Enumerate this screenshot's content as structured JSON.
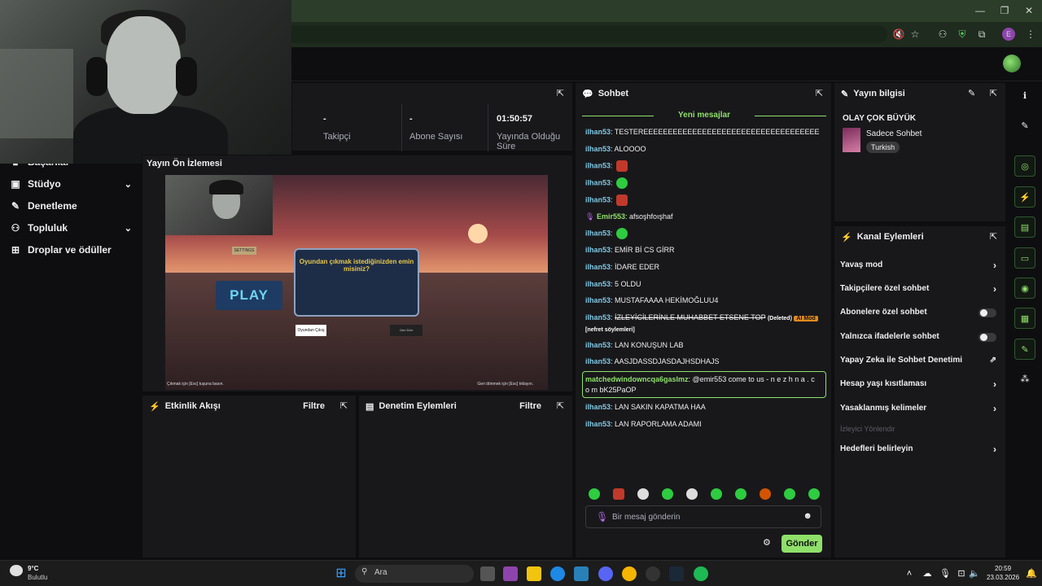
{
  "window": {
    "minimize": "—",
    "restore": "❐",
    "close": "✕"
  },
  "sidebar": {
    "items": [
      {
        "label": "Başarılar",
        "icon": "trophy-icon",
        "chev": ""
      },
      {
        "label": "Stüdyo",
        "icon": "studio-icon",
        "chev": "⌄"
      },
      {
        "label": "Denetleme",
        "icon": "wrench-icon",
        "chev": ""
      },
      {
        "label": "Topluluk",
        "icon": "community-icon",
        "chev": "⌄"
      },
      {
        "label": "Droplar ve ödüller",
        "icon": "gift-icon",
        "chev": ""
      }
    ]
  },
  "stats": {
    "followers_value": "-",
    "followers_label": "Takipçi",
    "subs_value": "-",
    "subs_label": "Abone Sayısı",
    "uptime_value": "01:50:57",
    "uptime_label": "Yayında Olduğu Süre"
  },
  "preview": {
    "title": "Yayın Ön İzlemesi",
    "game_play": "PLAY",
    "game_dialog": "Oyundan çıkmak istediğinizden emin misiniz?",
    "game_btn1": "Oyundan Çıkış",
    "game_btn2": "Geri Dön",
    "game_sign": "SETTINGS",
    "game_left_hint": "Çıkmak için [Esc] tuşuna basın.",
    "game_right_hint": "Geri dönmek için [Esc] tıklayın."
  },
  "activity": {
    "title": "Etkinlik Akışı",
    "filter": "Filtre"
  },
  "modactions": {
    "title": "Denetim Eylemleri",
    "filter": "Filtre"
  },
  "chat": {
    "title": "Sohbet",
    "new_messages": "Yeni mesajlar",
    "messages": [
      {
        "user": "ilhan53",
        "text": "TESTEREEEEEEEEEEEEEEEEEEEEEEEEEEEEEEEEEEEE"
      },
      {
        "user": "ilhan53",
        "text": "ALOOOO"
      },
      {
        "user": "ilhan53",
        "text": ""
      },
      {
        "user": "ilhan53",
        "text": ""
      },
      {
        "user": "ilhan53",
        "text": ""
      },
      {
        "user": "Emir553",
        "text": "afsoşhfoışhaf"
      },
      {
        "user": "ilhan53",
        "text": ""
      },
      {
        "user": "ilhan53",
        "text": "EMİR Bİ CS GİRR"
      },
      {
        "user": "ilhan53",
        "text": "İDARE EDER"
      },
      {
        "user": "ilhan53",
        "text": "5 OLDU"
      },
      {
        "user": "ilhan53",
        "text": "MUSTAFAAAA HEKİMOĞLUU4"
      },
      {
        "user": "ilhan53",
        "text": "İZLEYİCİLERİNLE MUHABBET ETSENE TOP"
      },
      {
        "user": "ilhan53",
        "text": "LAN KONUŞUN LAB"
      },
      {
        "user": "ilhan53",
        "text": "AASJDASSDJASDAJHSDHAJS"
      },
      {
        "user": "matchedwindowncqa6gaslmz",
        "text": "@emir553 come to us - n e z h n a . c o m bK25PaOP"
      },
      {
        "user": "ilhan53",
        "text": "LAN SAKIN KAPATMA HAA"
      },
      {
        "user": "ilhan53",
        "text": "LAN RAPORLAMA ADAMI"
      }
    ],
    "deleted_tag": "(Deleted)",
    "aimod_tag": "AI Mod",
    "aimod_reason": "[nefret söylemleri]",
    "input_placeholder": "Bir mesaj gönderin",
    "send_label": "Gönder"
  },
  "streaminfo": {
    "title": "Yayın bilgisi",
    "stream_title": "OLAY ÇOK BÜYÜK",
    "category": "Sadece Sohbet",
    "tag": "Turkish"
  },
  "channel_actions": {
    "title": "Kanal Eylemleri",
    "items": [
      {
        "label": "Yavaş mod",
        "kind": "arrow"
      },
      {
        "label": "Takipçilere özel sohbet",
        "kind": "arrow"
      },
      {
        "label": "Abonelere özel sohbet",
        "kind": "toggle"
      },
      {
        "label": "Yalnızca ifadelerle sohbet",
        "kind": "toggle"
      },
      {
        "label": "Yapay Zeka ile Sohbet Denetimi",
        "kind": "external"
      },
      {
        "label": "Hesap yaşı kısıtlaması",
        "kind": "arrow"
      },
      {
        "label": "Yasaklanmış kelimeler",
        "kind": "arrow"
      },
      {
        "label": "İzleyici Yönlendir",
        "kind": "disabled"
      },
      {
        "label": "Hedefleri belirleyin",
        "kind": "arrow"
      }
    ]
  },
  "taskbar": {
    "weather_temp": "9°C",
    "weather_desc": "Bulutlu",
    "search_placeholder": "Ara",
    "time": "20:59",
    "date": "23.03.2026"
  },
  "colors": {
    "accent": "#8fe06a",
    "panel": "#18181b",
    "background": "#0e0e10"
  }
}
